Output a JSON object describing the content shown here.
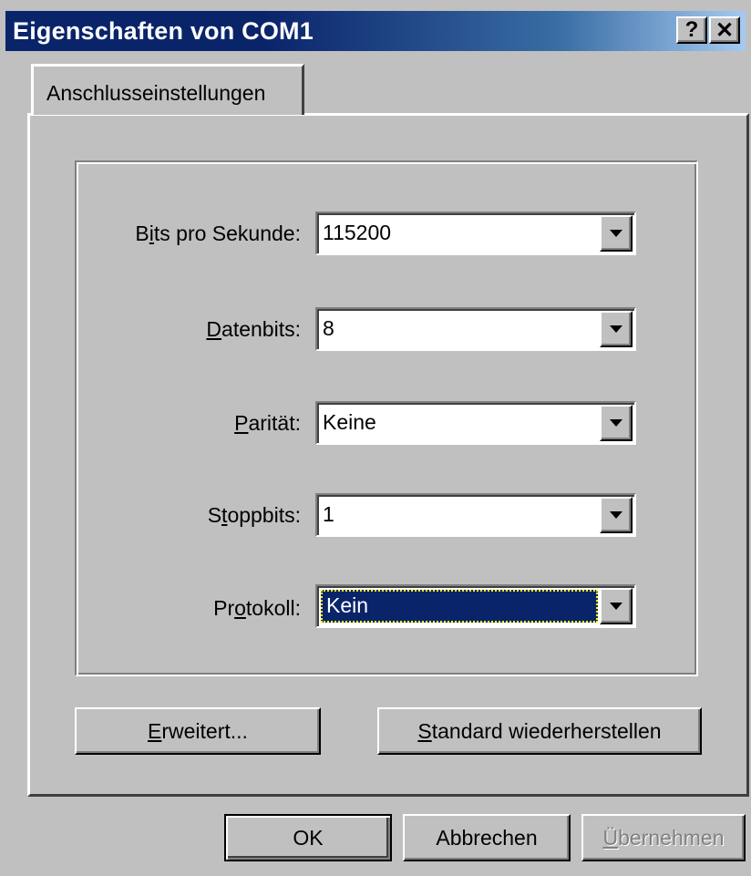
{
  "window": {
    "title": "Eigenschaften von COM1",
    "help_glyph": "?",
    "close_glyph": "✕"
  },
  "tabs": [
    {
      "label": "Anschlusseinstellungen",
      "active": true
    }
  ],
  "fields": [
    {
      "label_pre": "B",
      "label_u": "i",
      "label_post": "ts pro Sekunde:",
      "value": "115200"
    },
    {
      "label_pre": "",
      "label_u": "D",
      "label_post": "atenbits:",
      "value": "8"
    },
    {
      "label_pre": "",
      "label_u": "P",
      "label_post": "arität:",
      "value": "Keine"
    },
    {
      "label_pre": "S",
      "label_u": "t",
      "label_post": "oppbits:",
      "value": "1"
    },
    {
      "label_pre": "Pr",
      "label_u": "o",
      "label_post": "tokoll:",
      "value": "Kein"
    }
  ],
  "buttons": {
    "advanced_u": "E",
    "advanced_rest": "rweitert...",
    "restore_u": "S",
    "restore_rest": "tandard wiederherstellen",
    "ok": "OK",
    "cancel": "Abbrechen",
    "apply_u": "Ü",
    "apply_rest": "bernehmen"
  },
  "colors": {
    "face": "#c0c0c0",
    "titlebar": "#0a246a",
    "selection": "#0a246a"
  }
}
